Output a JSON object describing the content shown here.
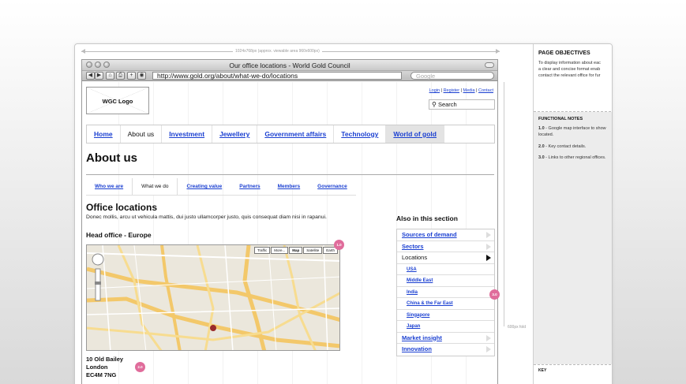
{
  "wireframe": {
    "dimension_label": "1024x768px (approx. viewable area 960x600px)",
    "fold_label": "600px fold"
  },
  "browser": {
    "window_title": "Our office locations - World Gold Council",
    "url": "http://www.gold.org/about/what-we-do/locations",
    "search_placeholder": "Google",
    "toolbar_buttons": [
      "◀",
      "▶",
      "⌂",
      "⎙",
      "+",
      "◉"
    ]
  },
  "site": {
    "logo_text": "WGC Logo",
    "utility_links": [
      "Login",
      "Register",
      "Media",
      "Contact"
    ],
    "search_label": "Search",
    "main_nav": [
      {
        "label": "Home",
        "state": "link"
      },
      {
        "label": "About us",
        "state": "active"
      },
      {
        "label": "Investment",
        "state": "link"
      },
      {
        "label": "Jewellery",
        "state": "link"
      },
      {
        "label": "Government affairs",
        "state": "link"
      },
      {
        "label": "Technology",
        "state": "link"
      },
      {
        "label": "World of gold",
        "state": "shaded"
      }
    ],
    "page_title": "About us",
    "sub_nav": [
      {
        "label": "Who we are",
        "state": "link"
      },
      {
        "label": "What we do",
        "state": "active"
      },
      {
        "label": "Creating value",
        "state": "link"
      },
      {
        "label": "Partners",
        "state": "link"
      },
      {
        "label": "Members",
        "state": "link"
      },
      {
        "label": "Governance",
        "state": "link"
      }
    ],
    "section_title": "Office locations",
    "intro_text": "Donec mollis, arcu ut vehicula mattis, dui justo ullamcorper justo, quis consequat diam nisi in rapanui.",
    "head_office_heading": "Head office - Europe",
    "map_types": [
      "Traffic",
      "More...",
      "Map",
      "Satellite",
      "Earth"
    ],
    "map_active_type": "Map",
    "address_lines": [
      "10 Old Bailey",
      "London",
      "EC4M 7NG"
    ],
    "badges": {
      "map": "1.0",
      "address": "2.0",
      "sidebar": "3.0"
    },
    "sidebar": {
      "title": "Also in this section",
      "items": [
        {
          "label": "Sources of demand",
          "type": "top"
        },
        {
          "label": "Sectors",
          "type": "top"
        },
        {
          "label": "Locations",
          "type": "current"
        },
        {
          "label": "USA",
          "type": "child"
        },
        {
          "label": "Middle East",
          "type": "child"
        },
        {
          "label": "India",
          "type": "child"
        },
        {
          "label": "China & the Far East",
          "type": "child"
        },
        {
          "label": "Singapore",
          "type": "child"
        },
        {
          "label": "Japan",
          "type": "child"
        },
        {
          "label": "Market insight",
          "type": "top"
        },
        {
          "label": "Innovation",
          "type": "top"
        }
      ]
    }
  },
  "notes": {
    "objectives_title": "PAGE OBJECTIVES",
    "objectives_lines": [
      "To display information about eac",
      "a clear and concise format enab",
      "contact the relevant office for fur"
    ],
    "functional_title": "FUNCTIONAL NOTES",
    "functional_notes": [
      {
        "num": "1.0",
        "text": " - Google map interface to show",
        "cont": "located."
      },
      {
        "num": "2.0",
        "text": " - Key contact details.",
        "cont": ""
      },
      {
        "num": "3.0",
        "text": " - Links to other regional offices.",
        "cont": ""
      }
    ],
    "key_title": "KEY"
  },
  "colors": {
    "link": "#1a3fd1",
    "badge": "#e06c9b",
    "nav_shaded": "#e3e3e3",
    "panel_bg": "#ececec"
  }
}
